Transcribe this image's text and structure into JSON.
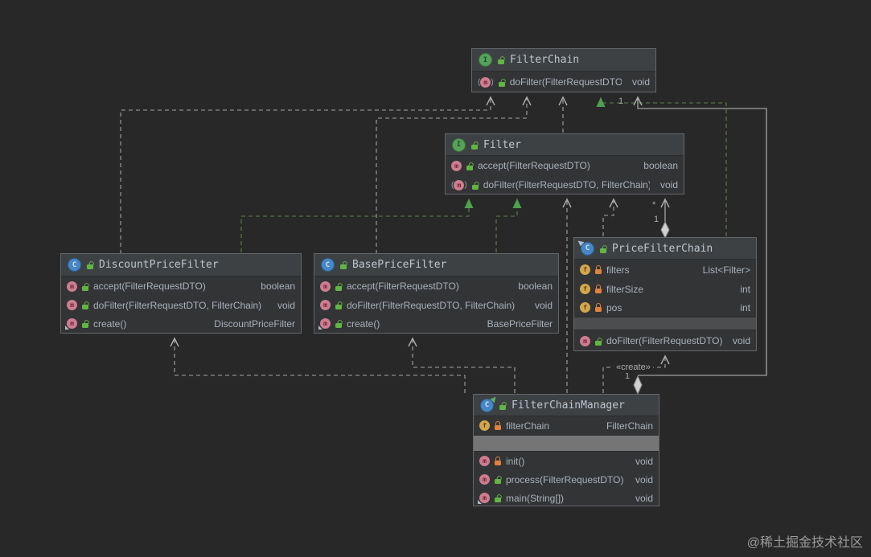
{
  "watermark": "@稀土掘金技术社区",
  "edge_labels": {
    "create_stereotype": "«create»",
    "manager_chain_mult_target": "1",
    "manager_chain_mult_source": "1",
    "chain_filter_mult_target": "*",
    "chain_filter_mult_source": "1"
  },
  "colors": {
    "background": "#282828",
    "node_body": "#333436",
    "node_header": "#3e4143",
    "realization_edge": "#5d814c",
    "realization_arrow": "#4da24d",
    "dependency_edge": "#a5a5a5",
    "association_edge": "#bdbdbd",
    "interface_icon": "#57a25b",
    "class_icon": "#4687c7",
    "method_icon": "#ce7d90",
    "field_icon": "#d2a74c",
    "public_lock": "#62b543",
    "private_lock": "#e0823d"
  },
  "classes": {
    "filter_chain": {
      "title": "FilterChain",
      "kind": "interface",
      "members": [
        {
          "icon": "abstract-method-icon",
          "lock": "public",
          "label": "doFilter(FilterRequestDTO)",
          "type": "void"
        }
      ]
    },
    "filter": {
      "title": "Filter",
      "kind": "interface",
      "members": [
        {
          "icon": "method-icon",
          "lock": "public",
          "label": "accept(FilterRequestDTO)",
          "type": "boolean"
        },
        {
          "icon": "abstract-method-icon",
          "lock": "public",
          "label": "doFilter(FilterRequestDTO, FilterChain)",
          "type": "void"
        }
      ]
    },
    "discount_price_filter": {
      "title": "DiscountPriceFilter",
      "kind": "class",
      "members": [
        {
          "icon": "method-icon",
          "lock": "public",
          "label": "accept(FilterRequestDTO)",
          "type": "boolean"
        },
        {
          "icon": "method-icon",
          "lock": "public",
          "label": "doFilter(FilterRequestDTO, FilterChain)",
          "type": "void"
        },
        {
          "icon": "static-method-icon",
          "lock": "public",
          "label": "create()",
          "type": "DiscountPriceFilter"
        }
      ]
    },
    "base_price_filter": {
      "title": "BasePriceFilter",
      "kind": "class",
      "members": [
        {
          "icon": "method-icon",
          "lock": "public",
          "label": "accept(FilterRequestDTO)",
          "type": "boolean"
        },
        {
          "icon": "method-icon",
          "lock": "public",
          "label": "doFilter(FilterRequestDTO, FilterChain)",
          "type": "void"
        },
        {
          "icon": "static-method-icon",
          "lock": "public",
          "label": "create()",
          "type": "BasePriceFilter"
        }
      ]
    },
    "price_filter_chain": {
      "title": "PriceFilterChain",
      "kind": "class",
      "fields": [
        {
          "icon": "field-icon",
          "lock": "private",
          "label": "filters",
          "type": "List<Filter>"
        },
        {
          "icon": "field-icon",
          "lock": "private",
          "label": "filterSize",
          "type": "int"
        },
        {
          "icon": "field-icon",
          "lock": "private",
          "label": "pos",
          "type": "int"
        }
      ],
      "methods": [
        {
          "icon": "method-icon",
          "lock": "public",
          "label": "doFilter(FilterRequestDTO)",
          "type": "void"
        }
      ]
    },
    "filter_chain_manager": {
      "title": "FilterChainManager",
      "kind": "class-runnable",
      "fields": [
        {
          "icon": "field-icon",
          "lock": "private",
          "label": "filterChain",
          "type": "FilterChain"
        }
      ],
      "methods": [
        {
          "icon": "method-icon",
          "lock": "private",
          "label": "init()",
          "type": "void"
        },
        {
          "icon": "method-icon",
          "lock": "public",
          "label": "process(FilterRequestDTO)",
          "type": "void"
        },
        {
          "icon": "static-method-icon",
          "lock": "public",
          "label": "main(String[])",
          "type": "void"
        }
      ]
    }
  }
}
